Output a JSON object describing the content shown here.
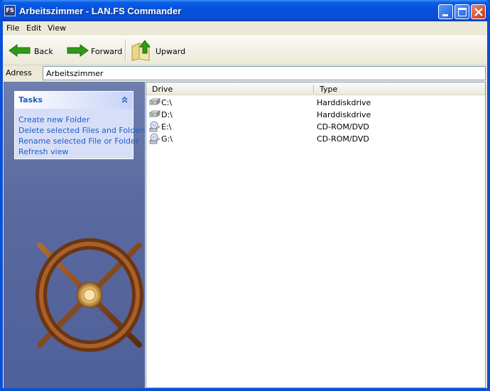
{
  "window": {
    "title": "Arbeitszimmer - LAN.FS Commander",
    "icon_text": "FS"
  },
  "menu": {
    "items": [
      "File",
      "Edit",
      "View"
    ]
  },
  "toolbar": {
    "back_label": "Back",
    "forward_label": "Forward",
    "upward_label": "Upward"
  },
  "address": {
    "label": "Adress",
    "value": "Arbeitszimmer"
  },
  "tasks": {
    "title": "Tasks",
    "items": [
      "Create new Folder",
      "Delete selected Files and Folders",
      "Rename selected File or Folder",
      "Refresh view"
    ]
  },
  "list": {
    "columns": [
      "Drive",
      "Type"
    ],
    "rows": [
      {
        "drive": "C:\\",
        "type": "Harddiskdrive",
        "icon": "harddisk-icon"
      },
      {
        "drive": "D:\\",
        "type": "Harddiskdrive",
        "icon": "harddisk-icon"
      },
      {
        "drive": "E:\\",
        "type": "CD-ROM/DVD",
        "icon": "cdrom-icon"
      },
      {
        "drive": "G:\\",
        "type": "CD-ROM/DVD",
        "icon": "cdrom-icon"
      }
    ]
  },
  "colors": {
    "titlebar": "#0a4fd8",
    "task_link": "#215dc6",
    "pane_background": "#5a6aa0",
    "arrow_green": "#2f9a1a"
  }
}
